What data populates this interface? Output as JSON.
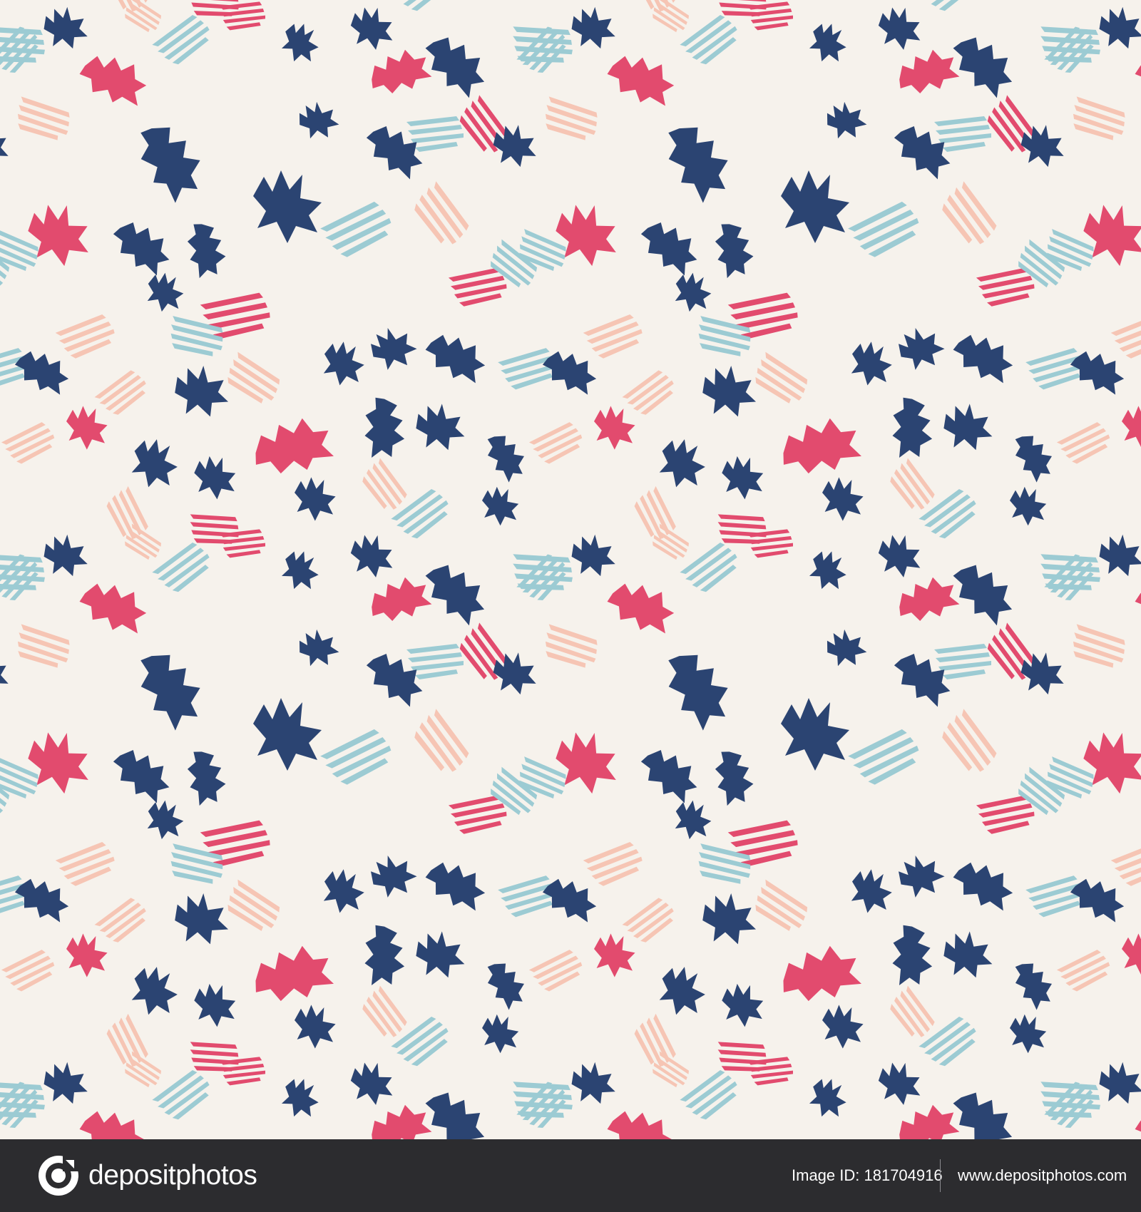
{
  "pattern": {
    "background_color": "#f6f2ec",
    "palette": {
      "navy": "#2b4472",
      "crimson": "#e24b6e",
      "light_blue": "#9ccbd3",
      "peach": "#f6c5b4"
    }
  },
  "footer": {
    "background_color": "#2c2c2f",
    "logo_icon": "depositphotos-camera-logo",
    "brand_name": "depositphotos",
    "image_id": "Image ID: 181704916",
    "url": "www.depositphotos.com"
  }
}
